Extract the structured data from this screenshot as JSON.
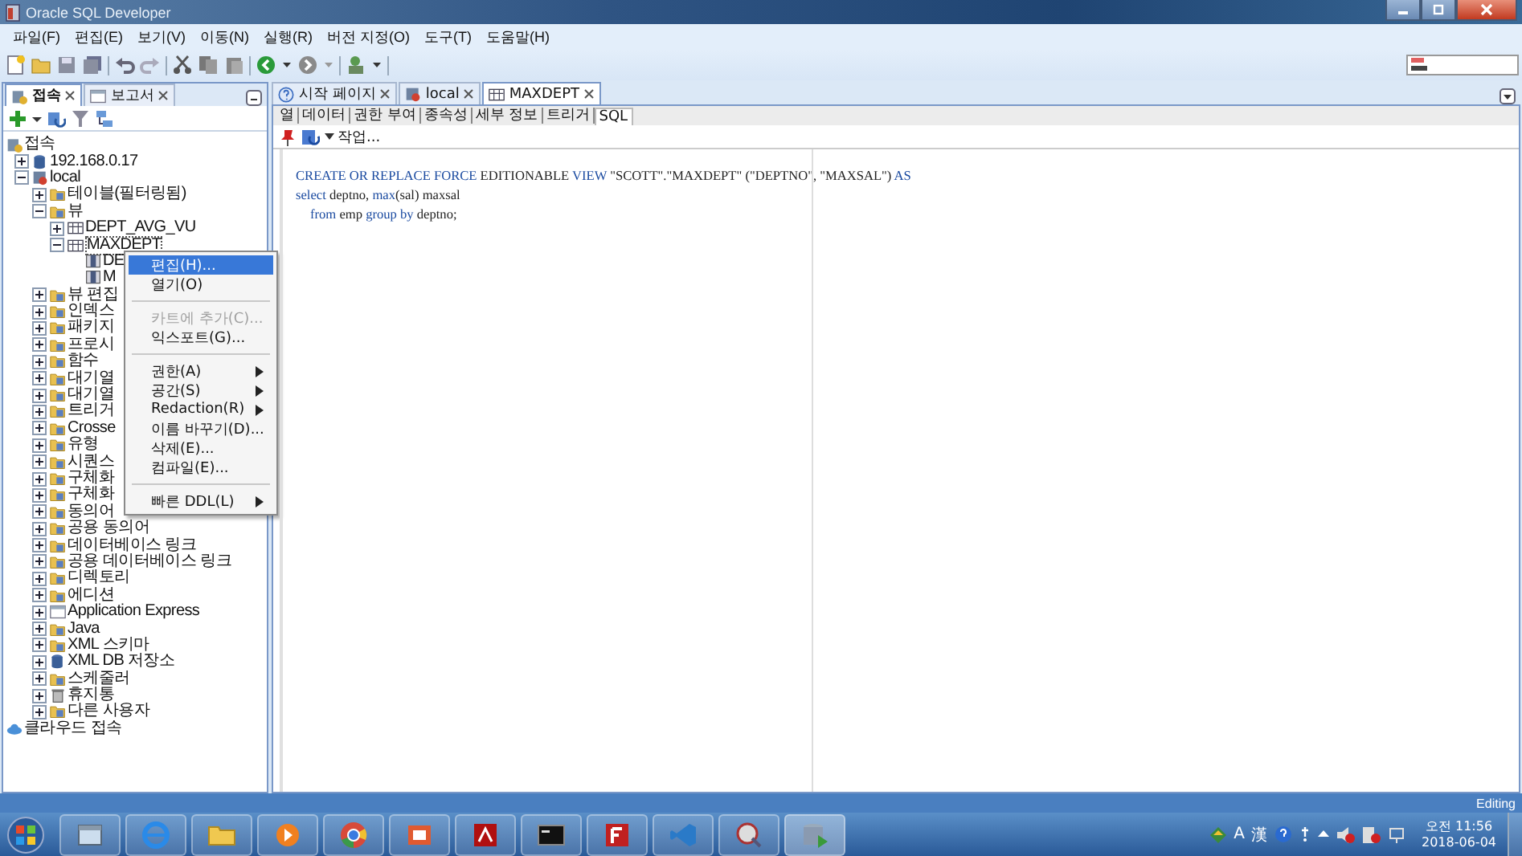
{
  "window": {
    "title": "Oracle SQL Developer"
  },
  "menu": [
    "파일(F)",
    "편집(E)",
    "보기(V)",
    "이동(N)",
    "실행(R)",
    "버전 지정(O)",
    "도구(T)",
    "도움말(H)"
  ],
  "left_tabs": [
    {
      "label": "접속",
      "selected": true
    },
    {
      "label": "보고서",
      "selected": false
    }
  ],
  "tree": [
    {
      "label": "접속",
      "kind": "connections",
      "children": [
        {
          "label": "192.168.0.17",
          "kind": "db",
          "expanded": false
        },
        {
          "label": "local",
          "kind": "connection",
          "expanded": true,
          "children": [
            {
              "label": "테이블(필터링됨)",
              "kind": "folder",
              "expanded": false
            },
            {
              "label": "뷰",
              "kind": "folder",
              "expanded": true,
              "children": [
                {
                  "label": "DEPT_AVG_VU",
                  "kind": "view",
                  "expanded": false
                },
                {
                  "label": "MAXDEPT",
                  "kind": "view",
                  "expanded": true,
                  "selected": true,
                  "children": [
                    {
                      "label": "DE",
                      "kind": "column"
                    },
                    {
                      "label": "M",
                      "kind": "column"
                    }
                  ]
                }
              ]
            },
            {
              "label": "뷰 편집",
              "kind": "folder",
              "expanded": false
            },
            {
              "label": "인덱스",
              "kind": "folder",
              "expanded": false
            },
            {
              "label": "패키지",
              "kind": "folder",
              "expanded": false
            },
            {
              "label": "프로시",
              "kind": "folder",
              "expanded": false
            },
            {
              "label": "함수",
              "kind": "folder",
              "expanded": false
            },
            {
              "label": "대기열",
              "kind": "folder",
              "expanded": false
            },
            {
              "label": "대기열",
              "kind": "folder",
              "expanded": false
            },
            {
              "label": "트리거",
              "kind": "folder",
              "expanded": false
            },
            {
              "label": "Crosse",
              "kind": "folder",
              "expanded": false
            },
            {
              "label": "유형",
              "kind": "folder",
              "expanded": false
            },
            {
              "label": "시퀀스",
              "kind": "folder",
              "expanded": false
            },
            {
              "label": "구체화",
              "kind": "folder",
              "expanded": false
            },
            {
              "label": "구체화",
              "kind": "folder",
              "expanded": false
            },
            {
              "label": "동의어",
              "kind": "folder",
              "expanded": false
            },
            {
              "label": "공용 동의어",
              "kind": "folder",
              "expanded": false
            },
            {
              "label": "데이터베이스 링크",
              "kind": "folder",
              "expanded": false
            },
            {
              "label": "공용 데이터베이스 링크",
              "kind": "folder",
              "expanded": false
            },
            {
              "label": "디렉토리",
              "kind": "folder",
              "expanded": false
            },
            {
              "label": "에디션",
              "kind": "folder",
              "expanded": false
            },
            {
              "label": "Application Express",
              "kind": "window",
              "expanded": false
            },
            {
              "label": "Java",
              "kind": "folder",
              "expanded": false
            },
            {
              "label": "XML 스키마",
              "kind": "folder",
              "expanded": false
            },
            {
              "label": "XML DB 저장소",
              "kind": "db",
              "expanded": false
            },
            {
              "label": "스케줄러",
              "kind": "folder",
              "expanded": false
            },
            {
              "label": "휴지통",
              "kind": "trash",
              "expanded": false
            },
            {
              "label": "다른 사용자",
              "kind": "folder",
              "expanded": false
            }
          ]
        }
      ]
    },
    {
      "label": "클라우드 접속",
      "kind": "cloud"
    }
  ],
  "context_menu": [
    {
      "kind": "item",
      "label": "편집(H)...",
      "selected": true,
      "disabled": false,
      "submenu": false
    },
    {
      "kind": "item",
      "label": "열기(O)",
      "selected": false,
      "disabled": false,
      "submenu": false
    },
    {
      "kind": "separator"
    },
    {
      "kind": "item",
      "label": "카트에 추가(C)...",
      "selected": false,
      "disabled": true,
      "submenu": false
    },
    {
      "kind": "item",
      "label": "익스포트(G)...",
      "selected": false,
      "disabled": false,
      "submenu": false
    },
    {
      "kind": "separator"
    },
    {
      "kind": "item",
      "label": "권한(A)",
      "selected": false,
      "disabled": false,
      "submenu": true
    },
    {
      "kind": "item",
      "label": "공간(S)",
      "selected": false,
      "disabled": false,
      "submenu": true
    },
    {
      "kind": "item",
      "label": "Redaction(R)",
      "selected": false,
      "disabled": false,
      "submenu": true
    },
    {
      "kind": "item",
      "label": "이름 바꾸기(D)...",
      "selected": false,
      "disabled": false,
      "submenu": false
    },
    {
      "kind": "item",
      "label": "삭제(E)...",
      "selected": false,
      "disabled": false,
      "submenu": false
    },
    {
      "kind": "item",
      "label": "컴파일(E)...",
      "selected": false,
      "disabled": false,
      "submenu": false
    },
    {
      "kind": "separator"
    },
    {
      "kind": "item",
      "label": "빠른 DDL(L)",
      "selected": false,
      "disabled": false,
      "submenu": true
    }
  ],
  "doc_tabs": [
    {
      "label": "시작 페이지",
      "kind": "help",
      "selected": false
    },
    {
      "label": "local",
      "kind": "connection",
      "selected": false
    },
    {
      "label": "MAXDEPT",
      "kind": "view",
      "selected": true
    }
  ],
  "sub_tabs": [
    {
      "label": "열",
      "selected": false
    },
    {
      "label": "데이터",
      "selected": false
    },
    {
      "label": "권한 부여",
      "selected": false
    },
    {
      "label": "종속성",
      "selected": false
    },
    {
      "label": "세부 정보",
      "selected": false
    },
    {
      "label": "트리거",
      "selected": false
    },
    {
      "label": "SQL",
      "selected": true
    }
  ],
  "editor_toolbar": {
    "action": "작업..."
  },
  "code": [
    {
      "indented": false,
      "segments": [
        {
          "kind": "keyword",
          "text": "CREATE OR REPLACE FORCE"
        },
        {
          "kind": "plain",
          "text": " EDITIONABLE "
        },
        {
          "kind": "keyword",
          "text": "VIEW"
        },
        {
          "kind": "plain",
          "text": " \"SCOTT\".\"MAXDEPT\" (\"DEPTNO\", \"MAXSAL\") "
        },
        {
          "kind": "keyword",
          "text": "AS"
        }
      ]
    },
    {
      "indented": false,
      "segments": [
        {
          "kind": "keyword",
          "text": "select"
        },
        {
          "kind": "plain",
          "text": " deptno, "
        },
        {
          "kind": "keyword",
          "text": "max"
        },
        {
          "kind": "plain",
          "text": "(sal) maxsal"
        }
      ]
    },
    {
      "indented": true,
      "segments": [
        {
          "kind": "keyword",
          "text": "from"
        },
        {
          "kind": "plain",
          "text": " emp "
        },
        {
          "kind": "keyword",
          "text": "group by"
        },
        {
          "kind": "plain",
          "text": " deptno;"
        }
      ]
    }
  ],
  "status_bar": {
    "mode": "Editing"
  },
  "taskbar": {
    "tray": [
      "A",
      "漢"
    ],
    "time": "오전 11:56",
    "date": "2018-06-04"
  }
}
